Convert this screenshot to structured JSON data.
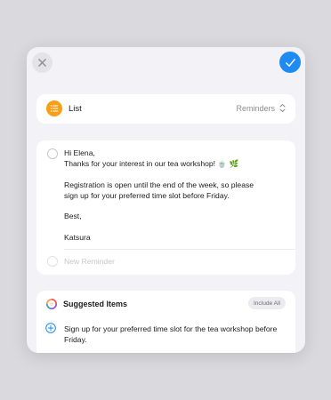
{
  "header": {
    "close_icon": "close-icon",
    "done_icon": "checkmark-icon",
    "done_color": "#1e8bf2"
  },
  "list": {
    "label": "List",
    "value": "Reminders",
    "icon": "list-bullet-icon",
    "icon_color": "#f6a01a"
  },
  "reminder": {
    "lines": [
      "Hi Elena,",
      "Thanks for your interest in our tea workshop! 🍵 🌿",
      "",
      "Registration is open until the end of the week, so please",
      "sign up for your preferred time slot before Friday.",
      "",
      "Best,",
      "",
      "Katsura"
    ],
    "new_placeholder": "New Reminder"
  },
  "suggested": {
    "title": "Suggested Items",
    "include_all": "Include All",
    "item_text": "Sign up for your preferred time slot for the tea workshop before Friday."
  }
}
